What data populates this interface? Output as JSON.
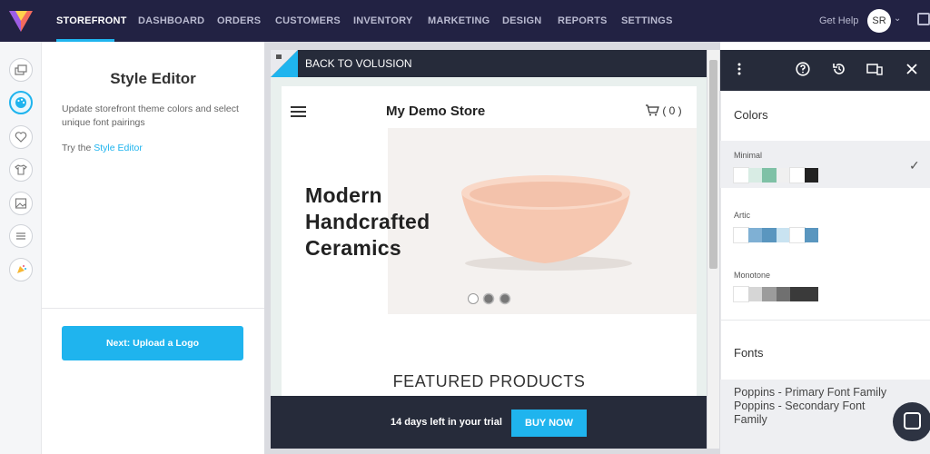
{
  "nav": {
    "items": [
      "STOREFRONT",
      "DASHBOARD",
      "ORDERS",
      "CUSTOMERS",
      "INVENTORY",
      "MARKETING",
      "DESIGN",
      "REPORTS",
      "SETTINGS"
    ],
    "active": "STOREFRONT",
    "help_label": "Get Help",
    "avatar_initials": "SR"
  },
  "left_panel": {
    "title": "Style Editor",
    "description": "Update storefront theme colors and select unique font pairings",
    "try_prefix": "Try the ",
    "try_link": "Style Editor",
    "next_button": "Next: Upload a Logo"
  },
  "rail_icons": [
    "layers-icon",
    "palette-icon",
    "heart-icon",
    "tshirt-icon",
    "image-icon",
    "list-icon",
    "megaphone-icon"
  ],
  "preview": {
    "back_label": "BACK TO VOLUSION",
    "store_name": "My Demo Store",
    "cart_count": "( 0 )",
    "hero_line1": "Modern",
    "hero_line2": "Handcrafted",
    "hero_line3": "Ceramics",
    "featured_heading": "FEATURED PRODUCTS",
    "trial_text": "14 days left in your trial",
    "buy_now": "BUY NOW",
    "carousel_active_index": 0,
    "carousel_count": 3
  },
  "right_panel": {
    "colors_label": "Colors",
    "themes": [
      {
        "name": "Minimal",
        "selected": true,
        "swatches": [
          "#ffffff",
          "#d8ece4",
          "#7fc1a6",
          "#f0f0f0",
          "#ffffff",
          "#222222"
        ]
      },
      {
        "name": "Artic",
        "selected": false,
        "swatches": [
          "#ffffff",
          "#7fb0d4",
          "#5a96bf",
          "#c9e3f1",
          "#ffffff",
          "#5a96bf"
        ]
      },
      {
        "name": "Monotone",
        "selected": false,
        "swatches": [
          "#ffffff",
          "#d6d6d6",
          "#9c9c9c",
          "#707070",
          "#3a3a3a",
          "#3a3a3a"
        ]
      }
    ],
    "fonts_label": "Fonts",
    "font_primary": "Poppins - Primary Font Family",
    "font_secondary_line1": "Poppins - Secondary Font",
    "font_secondary_line2": "Family"
  },
  "colors": {
    "accent": "#1fb4ee",
    "nav_bg": "#222243",
    "dark_bar": "#262b3a"
  }
}
